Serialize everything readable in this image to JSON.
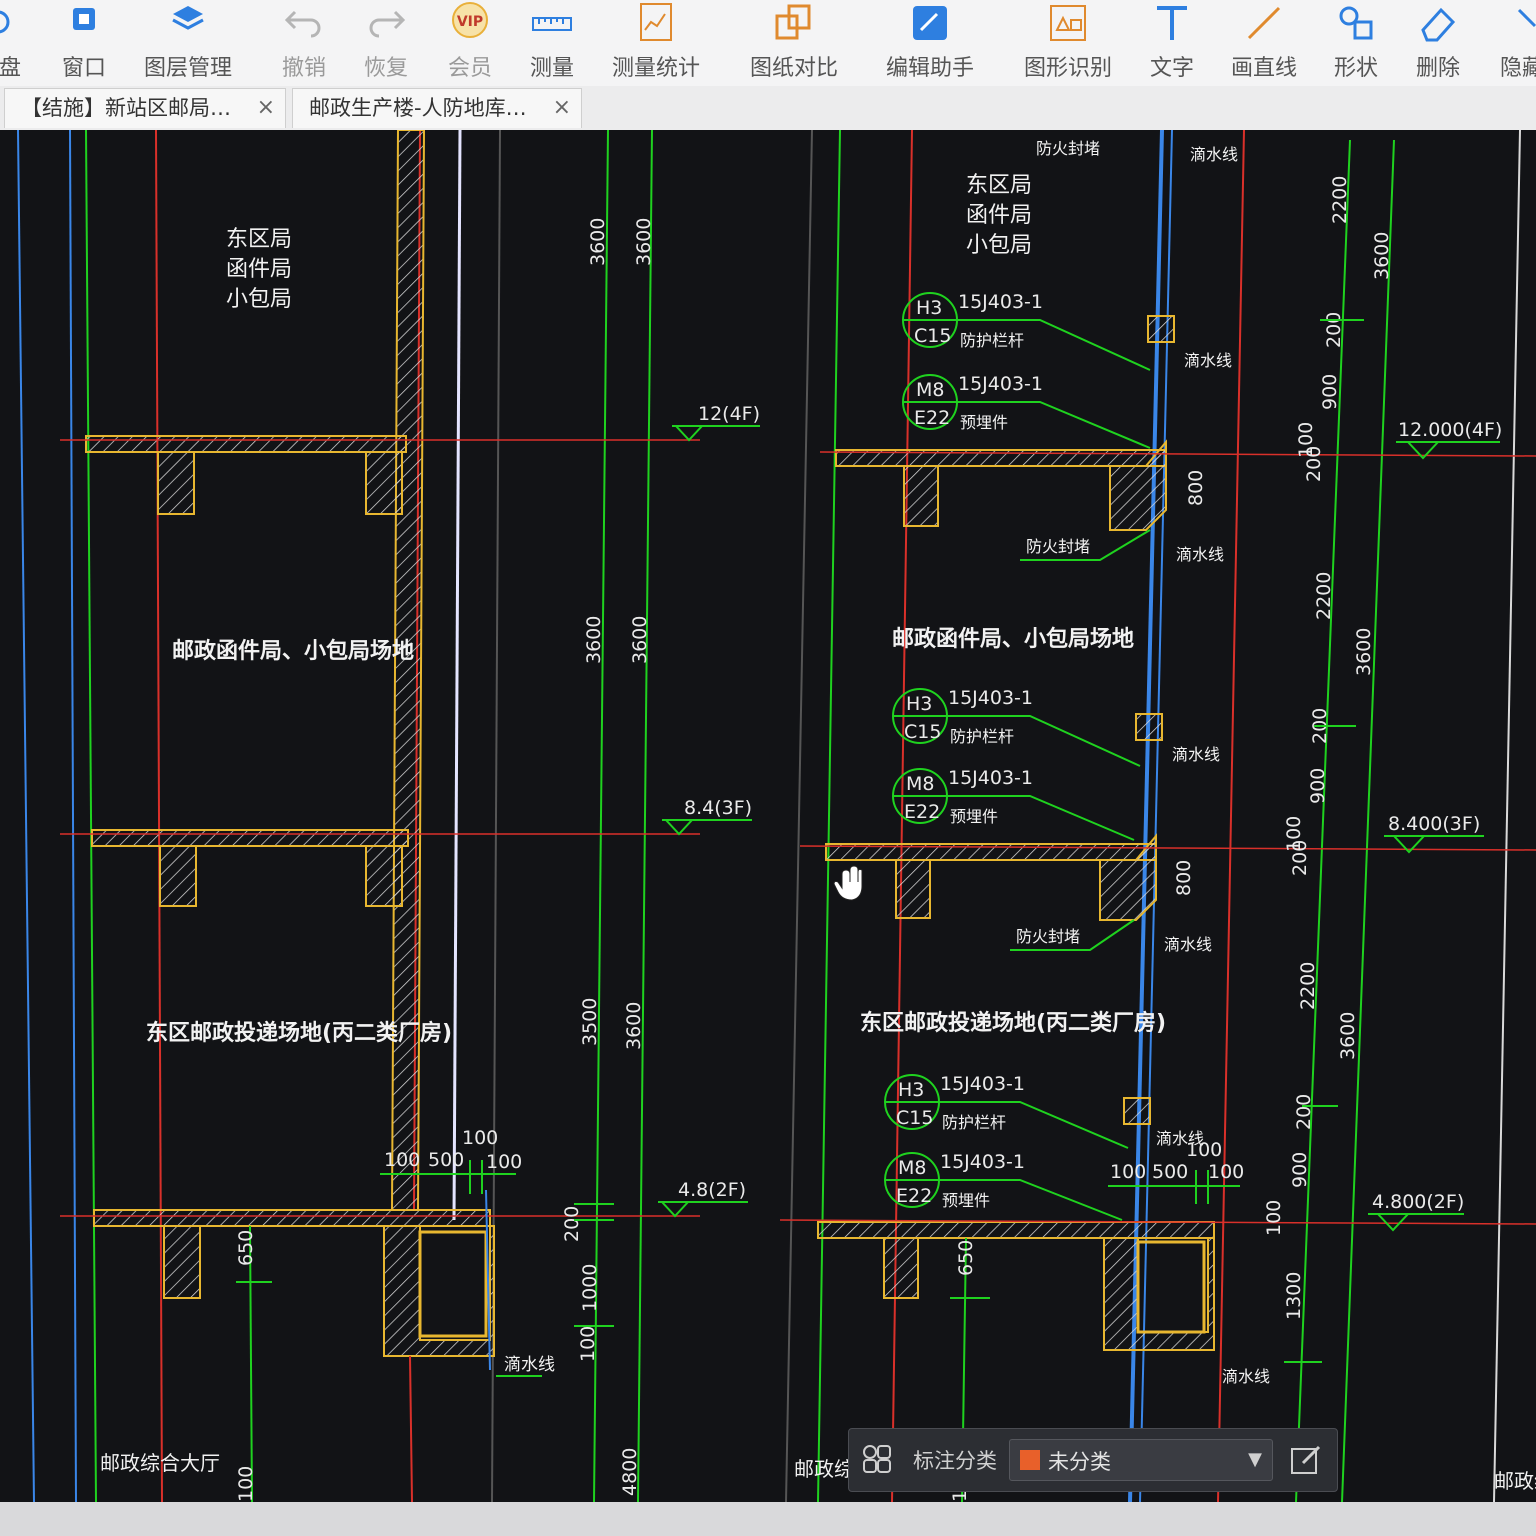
{
  "toolbar": {
    "items": [
      {
        "label": "盘"
      },
      {
        "label": "窗口"
      },
      {
        "label": "图层管理"
      },
      {
        "label": "撤销"
      },
      {
        "label": "恢复"
      },
      {
        "label": "会员",
        "badge": "VIP"
      },
      {
        "label": "测量"
      },
      {
        "label": "测量统计"
      },
      {
        "label": "图纸对比"
      },
      {
        "label": "编辑助手"
      },
      {
        "label": "图形识别"
      },
      {
        "label": "文字"
      },
      {
        "label": "画直线"
      },
      {
        "label": "形状"
      },
      {
        "label": "删除"
      },
      {
        "label": "隐藏"
      }
    ]
  },
  "tabs": [
    {
      "label": "【结施】新站区邮局…",
      "close": "×"
    },
    {
      "label": "邮政生产楼-人防地库…",
      "close": "×"
    }
  ],
  "drawing": {
    "left": {
      "room_top_lines": [
        "东区局",
        "函件局",
        "小包局"
      ],
      "room_mid": "邮政函件局、小包局场地",
      "room_low": "东区邮政投递场地(丙二类厂房)",
      "room_bottom": "邮政综合大厅",
      "levels": [
        "12(4F)",
        "8.4(3F)",
        "4.8(2F)"
      ],
      "dims_vertical": [
        "3600",
        "3600",
        "3600",
        "3600",
        "3500",
        "3600",
        "650",
        "200",
        "1000",
        "100",
        "4800",
        "100"
      ],
      "dims_bottom": [
        "100",
        "500",
        "100",
        "100"
      ],
      "drip_label": "滴水线"
    },
    "right": {
      "room_top_lines": [
        "东区局",
        "函件局",
        "小包局"
      ],
      "room_mid": "邮政函件局、小包局场地",
      "room_low": "东区邮政投递场地(丙二类厂房)",
      "room_bottom": "邮政综",
      "room_far": "邮政综",
      "top_label": "防火封堵",
      "levels": [
        "12.000(4F)",
        "8.400(3F)",
        "4.800(2F)"
      ],
      "dims_vertical": [
        "2200",
        "3600",
        "200",
        "900",
        "100",
        "200",
        "800",
        "2200",
        "3600",
        "200",
        "900",
        "100",
        "200",
        "800",
        "2200",
        "3600",
        "200",
        "900",
        "100",
        "1300",
        "650",
        "100"
      ],
      "dims_bottom": [
        "100",
        "500",
        "100",
        "100"
      ],
      "callouts": [
        {
          "top": "H3",
          "bottom": "C15",
          "ref": "15J403-1",
          "desc": "防护栏杆"
        },
        {
          "top": "M8",
          "bottom": "E22",
          "ref": "15J403-1",
          "desc": "预埋件"
        }
      ],
      "drip_label": "滴水线",
      "fire_label": "防火封堵"
    }
  },
  "annotation_bar": {
    "label": "标注分类",
    "selected": "未分类",
    "swatch_color": "#e8602a"
  },
  "colors": {
    "background": "#121316",
    "axis_green": "#1fd21f",
    "wall_yellow": "#e8b730",
    "grid_red": "#d9302a",
    "glass_blue": "#3a86e8"
  }
}
